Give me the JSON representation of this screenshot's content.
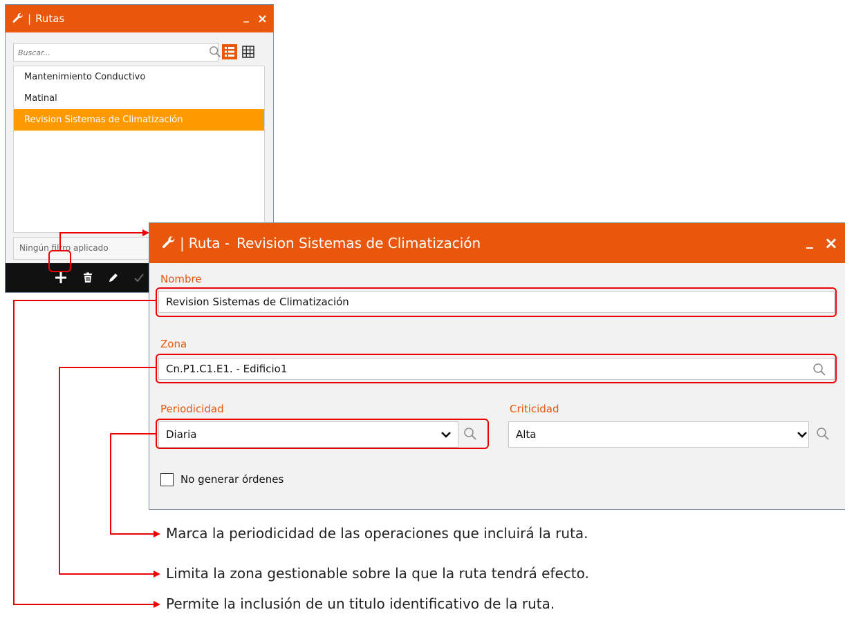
{
  "list_window": {
    "title": "Rutas",
    "minimize": "_",
    "close": "×",
    "search_placeholder": "Buscar...",
    "items": [
      {
        "label": "Mantenimiento Conductivo"
      },
      {
        "label": "Matinal"
      },
      {
        "label": "Revision Sistemas de Climatización",
        "selected": true
      }
    ],
    "filter_status": "Ningún filtro aplicado",
    "toolbar": [
      "add-icon",
      "trash-icon",
      "pencil-icon",
      "check-icon"
    ]
  },
  "detail_window": {
    "title_prefix": "Ruta -",
    "title_name": "Revision Sistemas de Climatización",
    "minimize": "_",
    "close": "×",
    "nombre": {
      "label": "Nombre",
      "value": "Revision Sistemas de Climatización"
    },
    "zona": {
      "label": "Zona",
      "value": "Cn.P1.C1.E1. - Edificio1"
    },
    "periodicidad": {
      "label": "Periodicidad",
      "value": "Diaria"
    },
    "criticidad": {
      "label": "Criticidad",
      "value": "Alta"
    },
    "no_generar": {
      "label": "No generar órdenes",
      "checked": false
    }
  },
  "annotations": [
    "Marca la periodicidad de las operaciones que incluirá la ruta.",
    "Limita la zona gestionable sobre la que la ruta tendrá efecto.",
    "Permite la inclusión de un titulo identificativo de la ruta."
  ],
  "colors": {
    "accent": "#e8570c",
    "selection": "#ff9900",
    "callout": "#ee0000"
  }
}
